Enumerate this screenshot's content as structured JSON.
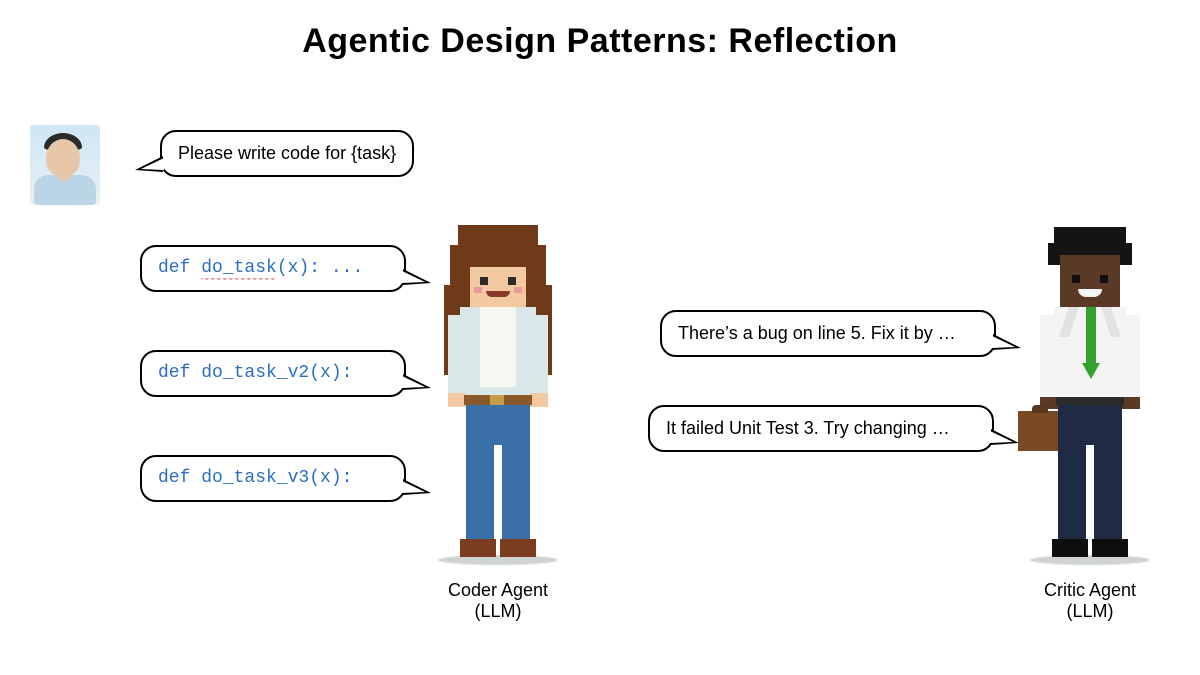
{
  "title": "Agentic Design Patterns: Reflection",
  "user_bubble": "Please write code for {task}",
  "coder": {
    "label_line1": "Coder Agent",
    "label_line2": "(LLM)",
    "bubbles": [
      {
        "prefix": "def ",
        "name": "do_task",
        "rest": "(x): ...",
        "squiggle": true
      },
      {
        "prefix": "def ",
        "name": "do_task_v2",
        "rest": "(x):",
        "squiggle": false
      },
      {
        "prefix": "def ",
        "name": "do_task_v3",
        "rest": "(x):",
        "squiggle": false
      }
    ]
  },
  "critic": {
    "label_line1": "Critic Agent",
    "label_line2": "(LLM)",
    "bubbles": [
      "There’s a bug on line 5. Fix it by …",
      "It failed Unit Test 3. Try changing …"
    ]
  },
  "colors": {
    "code": "#2a6fbf",
    "border": "#000000"
  }
}
